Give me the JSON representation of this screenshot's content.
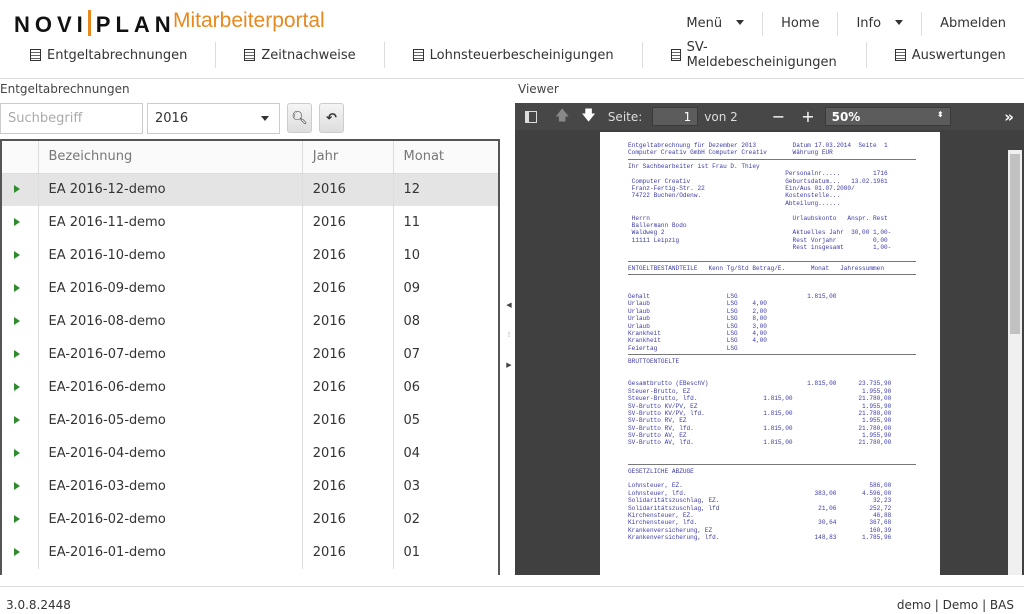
{
  "header": {
    "logo_left": "NOVI",
    "logo_right": "PLAN",
    "portal": "Mitarbeiterportal",
    "topnav": [
      {
        "label": "Menü",
        "dropdown": true
      },
      {
        "label": "Home"
      },
      {
        "label": "Info",
        "dropdown": true
      },
      {
        "label": "Abmelden"
      }
    ],
    "subnav": [
      "Entgeltabrechnungen",
      "Zeitnachweise",
      "Lohnsteuerbescheinigungen",
      "SV-Meldebescheinigungen",
      "Auswertungen"
    ]
  },
  "list": {
    "title": "Entgeltabrechnungen",
    "search_placeholder": "Suchbegriff",
    "year": "2016",
    "columns": [
      "",
      "Bezeichnung",
      "Jahr",
      "Monat"
    ],
    "rows": [
      [
        "EA 2016-12-demo",
        "2016",
        "12"
      ],
      [
        "EA 2016-11-demo",
        "2016",
        "11"
      ],
      [
        "EA 2016-10-demo",
        "2016",
        "10"
      ],
      [
        "EA 2016-09-demo",
        "2016",
        "09"
      ],
      [
        "EA 2016-08-demo",
        "2016",
        "08"
      ],
      [
        "EA-2016-07-demo",
        "2016",
        "07"
      ],
      [
        "EA-2016-06-demo",
        "2016",
        "06"
      ],
      [
        "EA-2016-05-demo",
        "2016",
        "05"
      ],
      [
        "EA-2016-04-demo",
        "2016",
        "04"
      ],
      [
        "EA-2016-03-demo",
        "2016",
        "03"
      ],
      [
        "EA-2016-02-demo",
        "2016",
        "02"
      ],
      [
        "EA-2016-01-demo",
        "2016",
        "01"
      ]
    ],
    "selected_index": 0
  },
  "viewer": {
    "title": "Viewer",
    "page_label": "Seite:",
    "page": "1",
    "of": "von 2",
    "zoom": "50%",
    "doc_lines": [
      "Entgeltabrechnung für Dezember 2013          Datum 17.03.2014  Seite  1",
      "Computer Creativ GmbH Computer Creativ       Währung EUR",
      "---",
      "Ihr Sachbearbeiter ist Frau D. Thiey",
      "                                           Personalnr.....         1716",
      " Computer Creativ                          Geburtsdatum...   13.02.1961",
      " Franz-Fertig-Str. 22                      Ein/Aus 01.07.2000/",
      " 74722 Buchen/Odenw.                       Kostenstelle...",
      "                                           Abteilung......",
      "",
      " Herrn                                       Urlaubskonto   Anspr. Rest",
      " Ballermann Bodo",
      " Waldweg 2                                   Aktuelles Jahr  30,00 1,00-",
      " 11111 Leipzig                               Rest Vorjahr          0,00",
      "                                             Rest insgesamt        1,00-",
      "",
      "---",
      "ENTGELTBESTANDTEILE   Kenn Tg/Std Betrag/E.       Monat   Jahressummen",
      "---",
      "",
      "",
      "Gehalt                     LSG                   1.815,00",
      "Urlaub                     LSG    4,00",
      "Urlaub                     LSG    2,00",
      "Urlaub                     LSG    8,00",
      "Urlaub                     LSG    3,00",
      "Krankheit                  LSG    4,00",
      "Krankheit                  LSG    4,00",
      "Feiertag                   LSG",
      "---",
      "BRUTTOENTGELTE",
      "",
      "",
      "Gesamtbrutto (EBeschV)                           1.815,00      23.735,90",
      "Steuer-Brutto, EZ                                               1.955,90",
      "Steuer-Brutto, lfd.                  1.815,00                  21.780,00",
      "SV-Brutto KV/PV, EZ                                             1.955,90",
      "SV-Brutto KV/PV, lfd.                1.815,00                  21.780,00",
      "SV-Brutto RV, EZ                                                1.955,90",
      "SV-Brutto RV, lfd.                   1.815,00                  21.780,00",
      "SV-Brutto AV, EZ                                                1.955,90",
      "SV-Brutto AV, lfd.                   1.815,00                  21.780,00",
      "",
      "",
      "---",
      "GESETZLICHE ABZUGE",
      "",
      "Lohnsteuer, EZ.                                                   586,00",
      "Lohnsteuer, lfd.                                   383,00       4.596,00",
      "Solidaritätszuschlag, EZ.                                          32,23",
      "Solidaritätszuschlag, lfd                           21,06         252,72",
      "Kirchensteuer, EZ.                                                 46,88",
      "Kirchensteuer, lfd.                                 30,64         367,68",
      "Krankenversicherung, EZ                                           160,39",
      "Krankenversicherung, lfd.                          148,83       1.785,96"
    ]
  },
  "footer": {
    "version": "3.0.8.2448",
    "user": "demo | Demo | BAS"
  }
}
